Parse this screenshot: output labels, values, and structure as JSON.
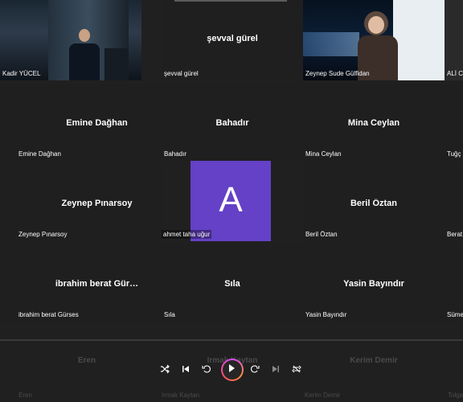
{
  "tiles": [
    {
      "name": "Kadir YÜCEL",
      "label": ""
    },
    {
      "name": "şevval gürel",
      "label": "şevval gürel"
    },
    {
      "name": "Zeynep Sude Gülfidan",
      "label": ""
    },
    {
      "name": "ALİ C",
      "label": ""
    },
    {
      "name": "Emine Dağhan",
      "label": "Emine Dağhan"
    },
    {
      "name": "Bahadır",
      "label": "Bahadır"
    },
    {
      "name": "Mina Ceylan",
      "label": "Mina Ceylan"
    },
    {
      "name": "Tuğç",
      "label": ""
    },
    {
      "name": "Zeynep Pınarsoy",
      "label": "Zeynep Pınarsoy"
    },
    {
      "name": "Beril Öztan",
      "label": "Beril Öztan"
    },
    {
      "name": "Berat",
      "label": ""
    },
    {
      "name": "ibrahim berat Gürses",
      "label": "ibrahim berat Gür…"
    },
    {
      "name": "Sıla",
      "label": "Sıla"
    },
    {
      "name": "Yasin Bayındır",
      "label": "Yasin Bayındır"
    },
    {
      "name": "Süme",
      "label": ""
    }
  ],
  "active_speaker": {
    "letter": "A",
    "name": "ahmet taha uğur"
  },
  "bottom_row": [
    {
      "name": "Eren",
      "label": "Eren"
    },
    {
      "name": "Irmak Kaytan",
      "label": "Irmak Kaytan"
    },
    {
      "name": "Kerim Demir",
      "label": "Kerim Demir"
    },
    {
      "name": "Tolga",
      "label": ""
    }
  ],
  "controls": {
    "shuffle": "shuffle-icon",
    "prev": "previous-icon",
    "rewind": "rewind-10-icon",
    "play": "play-icon",
    "forward": "forward-10-icon",
    "next": "next-icon",
    "loop": "loop-icon"
  },
  "colors": {
    "avatar": "#6441c6",
    "background": "#202020"
  }
}
